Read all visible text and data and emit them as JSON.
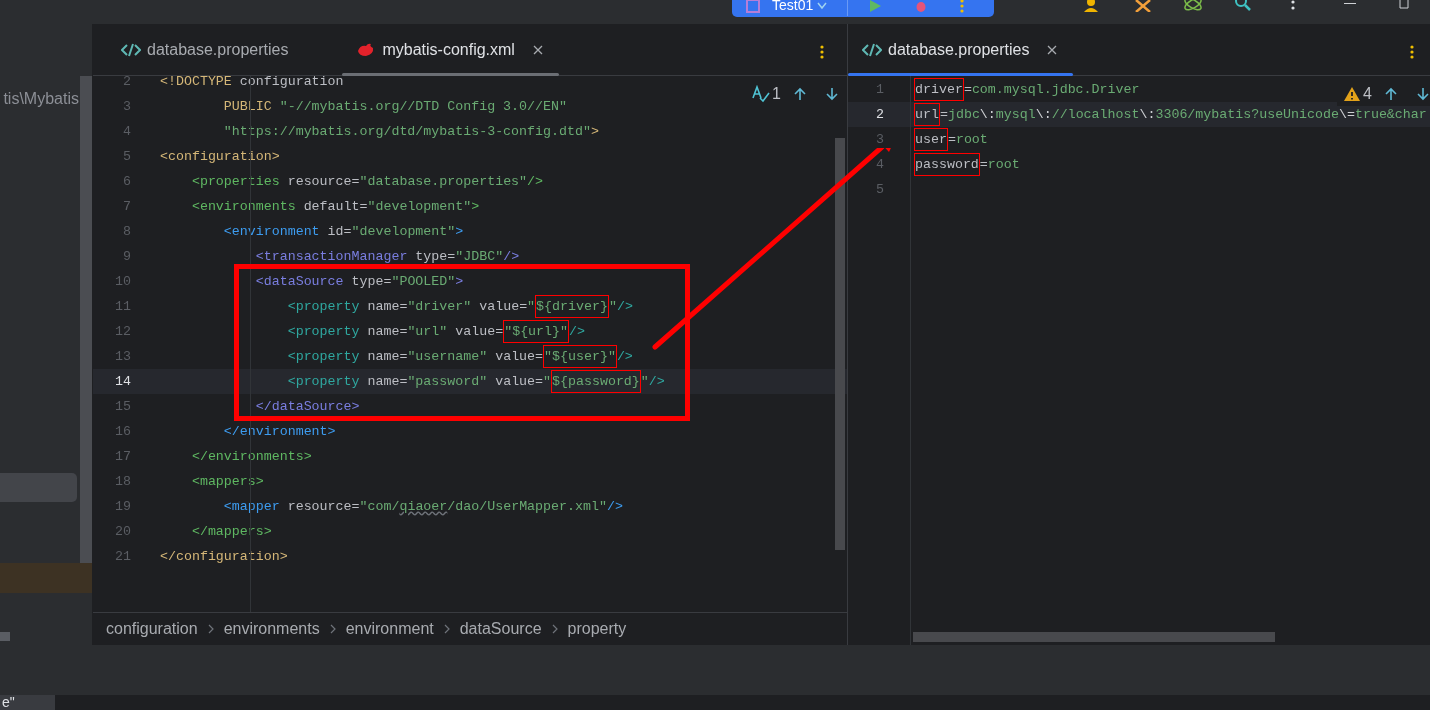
{
  "toolbar": {
    "run_config": "Test01"
  },
  "sidebar": {
    "path_text": "tis\\Mybatis"
  },
  "left_editor": {
    "tabs": [
      {
        "label": "database.properties",
        "kind": "properties",
        "selected": false,
        "closable": false
      },
      {
        "label": "mybatis-config.xml",
        "kind": "mybatis",
        "selected": true,
        "closable": true
      }
    ],
    "inspection_count": "1",
    "lines": [
      {
        "number": "2",
        "current": false,
        "tokens": [
          {
            "kind": "gold",
            "text": "<!DOCTYPE"
          },
          {
            "kind": "plain",
            "text": " configuration"
          }
        ]
      },
      {
        "number": "3",
        "current": false,
        "tokens": [
          {
            "kind": "gold",
            "text": "        PUBLIC"
          },
          {
            "kind": "str",
            "text": " \"-//mybatis.org//DTD Config 3.0//EN\""
          }
        ]
      },
      {
        "number": "4",
        "current": false,
        "tokens": [
          {
            "kind": "str",
            "text": "        \"https://mybatis.org/dtd/mybatis-3-config.dtd\""
          },
          {
            "kind": "gold",
            "text": ">"
          }
        ]
      },
      {
        "number": "5",
        "current": false,
        "tokens": [
          {
            "kind": "tag",
            "color": "#d5b778",
            "text": "<configuration>"
          }
        ]
      },
      {
        "number": "6",
        "current": false,
        "tokens": [
          {
            "kind": "tag",
            "color": "#5fb862",
            "text": "    <properties"
          },
          {
            "kind": "attr",
            "text": " resource"
          },
          {
            "kind": "eq",
            "text": "="
          },
          {
            "kind": "str",
            "text": "\"database.properties\""
          },
          {
            "kind": "tag_end",
            "text": "/>"
          }
        ]
      },
      {
        "number": "7",
        "current": false,
        "tokens": [
          {
            "kind": "tag",
            "color": "#5fb862",
            "text": "    <environments"
          },
          {
            "kind": "attr",
            "text": " default"
          },
          {
            "kind": "eq",
            "text": "="
          },
          {
            "kind": "str",
            "text": "\"development\""
          },
          {
            "kind": "tag_end",
            "text": ">"
          }
        ]
      },
      {
        "number": "8",
        "current": false,
        "tokens": [
          {
            "kind": "tag",
            "color": "#3d9cf0",
            "text": "        <environment"
          },
          {
            "kind": "attr",
            "text": " id"
          },
          {
            "kind": "eq",
            "text": "="
          },
          {
            "kind": "str",
            "text": "\"development\""
          },
          {
            "kind": "tag_end",
            "text": ">"
          }
        ]
      },
      {
        "number": "9",
        "current": false,
        "tokens": [
          {
            "kind": "tag",
            "color": "#7a7ee0",
            "text": "            <transactionManager"
          },
          {
            "kind": "attr",
            "text": " type"
          },
          {
            "kind": "eq",
            "text": "="
          },
          {
            "kind": "str",
            "text": "\"JDBC\""
          },
          {
            "kind": "tag_end",
            "text": "/>"
          }
        ]
      },
      {
        "number": "10",
        "current": false,
        "tokens": [
          {
            "kind": "tag",
            "color": "#7a7ee0",
            "text": "            <dataSource"
          },
          {
            "kind": "attr",
            "text": " type"
          },
          {
            "kind": "eq",
            "text": "="
          },
          {
            "kind": "str",
            "text": "\"POOLED\""
          },
          {
            "kind": "tag_end",
            "text": ">"
          }
        ]
      },
      {
        "number": "11",
        "current": false,
        "tokens": [
          {
            "kind": "tag",
            "color": "#2fa8a0",
            "text": "                <property"
          },
          {
            "kind": "attr",
            "text": " name"
          },
          {
            "kind": "eq",
            "text": "="
          },
          {
            "kind": "str",
            "text": "\"driver\""
          },
          {
            "kind": "attr",
            "text": " value"
          },
          {
            "kind": "eq",
            "text": "="
          },
          {
            "kind": "str",
            "text": "\""
          },
          {
            "kind": "str",
            "text": "${driver}",
            "boxed": true
          },
          {
            "kind": "str",
            "text": "\""
          },
          {
            "kind": "tag_end",
            "text": "/>"
          }
        ]
      },
      {
        "number": "12",
        "current": false,
        "tokens": [
          {
            "kind": "tag",
            "color": "#2fa8a0",
            "text": "                <property"
          },
          {
            "kind": "attr",
            "text": " name"
          },
          {
            "kind": "eq",
            "text": "="
          },
          {
            "kind": "str",
            "text": "\"url\""
          },
          {
            "kind": "attr",
            "text": " value"
          },
          {
            "kind": "eq",
            "text": "="
          },
          {
            "kind": "str",
            "text": "\"${url}\"",
            "boxed": true
          },
          {
            "kind": "tag_end",
            "text": "/>"
          }
        ]
      },
      {
        "number": "13",
        "current": false,
        "tokens": [
          {
            "kind": "tag",
            "color": "#2fa8a0",
            "text": "                <property"
          },
          {
            "kind": "attr",
            "text": " name"
          },
          {
            "kind": "eq",
            "text": "="
          },
          {
            "kind": "str",
            "text": "\"username\""
          },
          {
            "kind": "attr",
            "text": " value"
          },
          {
            "kind": "eq",
            "text": "="
          },
          {
            "kind": "str",
            "text": "\"${user}\"",
            "boxed": true
          },
          {
            "kind": "tag_end",
            "text": "/>"
          }
        ]
      },
      {
        "number": "14",
        "current": true,
        "tokens": [
          {
            "kind": "tag",
            "color": "#2fa8a0",
            "text": "                <property"
          },
          {
            "kind": "attr",
            "text": " name"
          },
          {
            "kind": "eq",
            "text": "="
          },
          {
            "kind": "str",
            "text": "\"password\""
          },
          {
            "kind": "attr",
            "text": " value"
          },
          {
            "kind": "eq",
            "text": "="
          },
          {
            "kind": "str",
            "text": "\""
          },
          {
            "kind": "str",
            "text": "${password}",
            "boxed": true
          },
          {
            "kind": "str",
            "text": "\""
          },
          {
            "kind": "tag_end",
            "text": "/>"
          }
        ]
      },
      {
        "number": "15",
        "current": false,
        "tokens": [
          {
            "kind": "tag",
            "color": "#7a7ee0",
            "text": "            </dataSource>"
          }
        ]
      },
      {
        "number": "16",
        "current": false,
        "tokens": [
          {
            "kind": "tag",
            "color": "#3d9cf0",
            "text": "        </environment>"
          }
        ]
      },
      {
        "number": "17",
        "current": false,
        "tokens": [
          {
            "kind": "tag",
            "color": "#5fb862",
            "text": "    </environments>"
          }
        ]
      },
      {
        "number": "18",
        "current": false,
        "tokens": [
          {
            "kind": "tag",
            "color": "#5fb862",
            "text": "    <mappers>"
          }
        ]
      },
      {
        "number": "19",
        "current": false,
        "tokens": [
          {
            "kind": "tag",
            "color": "#3d9cf0",
            "text": "        <mapper"
          },
          {
            "kind": "attr",
            "text": " resource"
          },
          {
            "kind": "eq",
            "text": "="
          },
          {
            "kind": "str",
            "text": "\"com/"
          },
          {
            "kind": "str",
            "text": "qiaoer",
            "typo": true
          },
          {
            "kind": "str",
            "text": "/dao/UserMapper.xml\""
          },
          {
            "kind": "tag_end",
            "text": "/>"
          }
        ]
      },
      {
        "number": "20",
        "current": false,
        "tokens": [
          {
            "kind": "tag",
            "color": "#5fb862",
            "text": "    </mappers>"
          }
        ]
      },
      {
        "number": "21",
        "current": false,
        "tokens": [
          {
            "kind": "tag",
            "color": "#d5b778",
            "text": "</configuration>"
          }
        ]
      }
    ],
    "breadcrumb": [
      "configuration",
      "environments",
      "environment",
      "dataSource",
      "property"
    ]
  },
  "right_editor": {
    "tabs": [
      {
        "label": "database.properties",
        "kind": "properties",
        "selected": true,
        "closable": true
      }
    ],
    "warning_count": "4",
    "lines": [
      {
        "number": "1",
        "current": false,
        "tokens": [
          {
            "kind": "key",
            "text": "driver",
            "boxed": true
          },
          {
            "kind": "eq",
            "text": "="
          },
          {
            "kind": "value",
            "text": "com.mysql.jdbc.Driver"
          }
        ]
      },
      {
        "number": "2",
        "current": true,
        "tokens": [
          {
            "kind": "key",
            "text": "url",
            "boxed": true
          },
          {
            "kind": "eq",
            "text": "="
          },
          {
            "kind": "value",
            "text": "jdbc"
          },
          {
            "kind": "escape",
            "text": "\\:"
          },
          {
            "kind": "value",
            "text": "mysql"
          },
          {
            "kind": "escape",
            "text": "\\:"
          },
          {
            "kind": "value",
            "text": "//localhost"
          },
          {
            "kind": "escape",
            "text": "\\:"
          },
          {
            "kind": "value",
            "text": "3306/mybatis?useUnicode"
          },
          {
            "kind": "escape",
            "text": "\\="
          },
          {
            "kind": "value",
            "text": "true&char"
          }
        ]
      },
      {
        "number": "3",
        "current": false,
        "tokens": [
          {
            "kind": "key",
            "text": "user",
            "boxed": true
          },
          {
            "kind": "eq",
            "text": "="
          },
          {
            "kind": "value",
            "text": "root"
          }
        ]
      },
      {
        "number": "4",
        "current": false,
        "tokens": [
          {
            "kind": "key",
            "text": "password",
            "boxed": true
          },
          {
            "kind": "eq",
            "text": "="
          },
          {
            "kind": "value",
            "text": "root"
          }
        ]
      },
      {
        "number": "5",
        "current": false
      }
    ]
  },
  "status": {
    "tab_text": "e\""
  }
}
